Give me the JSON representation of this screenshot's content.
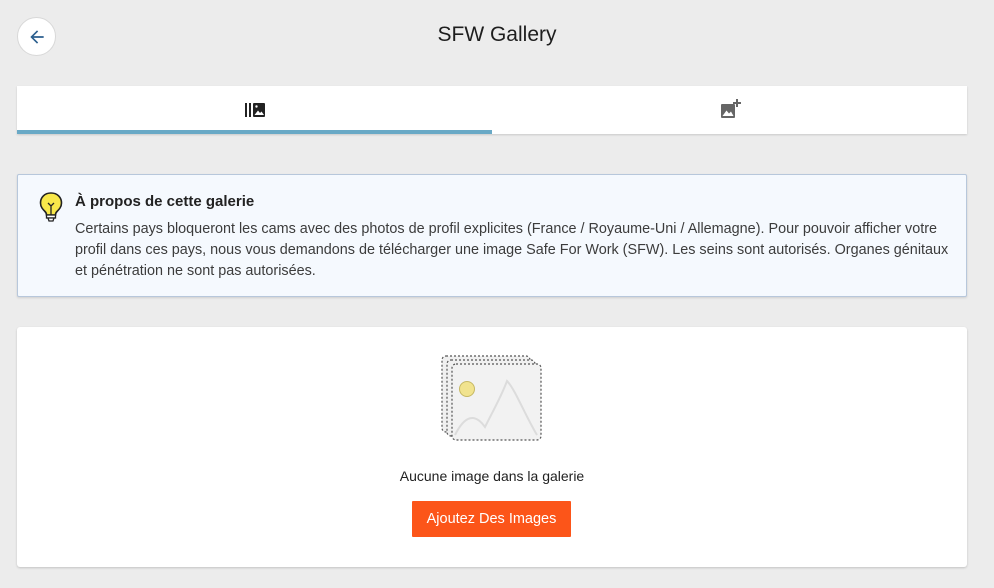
{
  "header": {
    "title": "SFW Gallery",
    "back_icon": "arrow-left-icon"
  },
  "tabs": [
    {
      "icon": "photo-library-icon",
      "active": true
    },
    {
      "icon": "add-photo-icon",
      "active": false
    }
  ],
  "colors": {
    "tab_indicator": "#69a9c6",
    "accent_button": "#fc5519",
    "info_background": "#f5f9fe",
    "back_arrow": "#2b5f8e"
  },
  "info": {
    "icon": "lightbulb-icon",
    "title": "À propos de cette galerie",
    "text": "Certains pays bloqueront les cams avec des photos de profil explicites (France / Royaume-Uni / Allemagne). Pour pouvoir afficher votre profil dans ces pays, nous vous demandons de télécharger une image Safe For Work (SFW). Les seins sont autorisés. Organes génitaux et pénétration ne sont pas autorisées."
  },
  "gallery": {
    "illustration_icon": "empty-gallery-icon",
    "empty_text": "Aucune image dans la galerie",
    "add_button_label": "Ajoutez Des Images"
  }
}
